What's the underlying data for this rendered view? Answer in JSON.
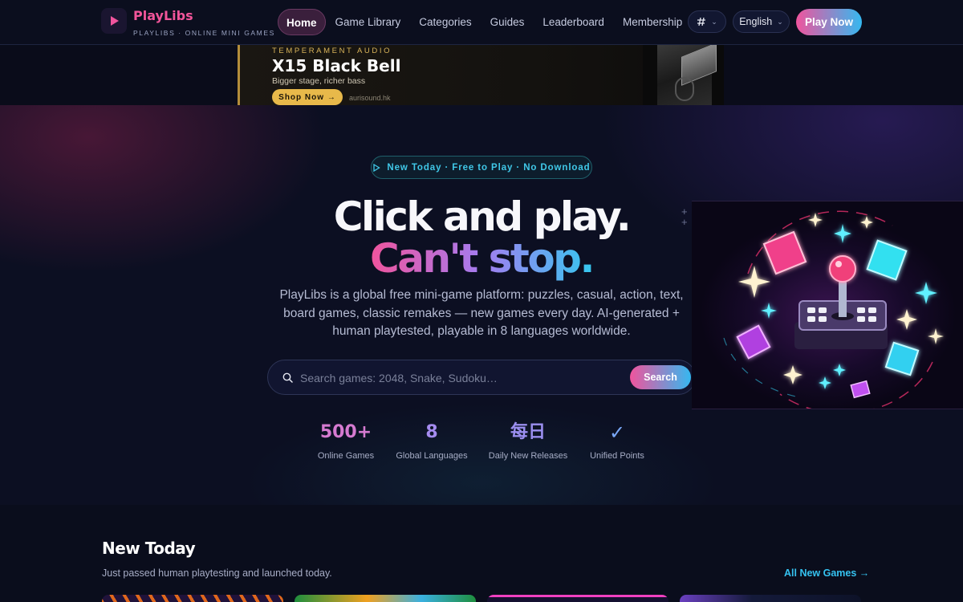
{
  "nav": {
    "brand": "PlayLibs",
    "tagline": "PLAYLIBS · ONLINE MINI GAMES",
    "links": [
      {
        "label": "Home",
        "active": true
      },
      {
        "label": "Game Library"
      },
      {
        "label": "Categories"
      },
      {
        "label": "Guides"
      },
      {
        "label": "Leaderboard"
      },
      {
        "label": "Membership"
      }
    ],
    "theme_icon": "theme-icon",
    "language": "English",
    "cta": "Play Now"
  },
  "ad": {
    "kicker": "TEMPERAMENT AUDIO",
    "title": "X15 Black Bell",
    "subtitle": "Bigger stage, richer bass",
    "button": "Shop Now →",
    "domain": "aurisound.hk"
  },
  "hero": {
    "badge": "New Today · Free to Play · No Download",
    "headline_line1": "Click and play.",
    "headline_line2": "Can't stop.",
    "description": "PlayLibs is a global free mini-game platform: puzzles, casual, action, text, board games, classic remakes — new games every day. AI-generated + human playtested, playable in 8 languages worldwide.",
    "search": {
      "placeholder": "Search games: 2048, Snake, Sudoku…",
      "button": "Search"
    },
    "stats": [
      {
        "value": "500+",
        "label": "Online Games"
      },
      {
        "value": "8",
        "label": "Global Languages"
      },
      {
        "value": "每日",
        "label": "Daily New Releases"
      },
      {
        "value": "✓",
        "label": "Unified Points"
      }
    ]
  },
  "new_today": {
    "title": "New Today",
    "subtitle": "Just passed human playtesting and launched today.",
    "link": "All New Games →"
  },
  "colors": {
    "accent_pink": "#f0549d",
    "accent_cyan": "#35c2f0",
    "background": "#0a0d1c"
  }
}
